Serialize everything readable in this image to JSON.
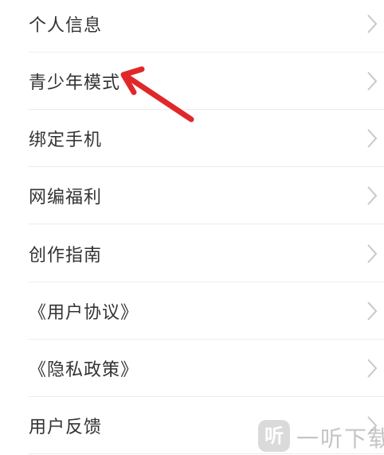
{
  "menu": {
    "items": [
      {
        "label": "个人信息"
      },
      {
        "label": "青少年模式"
      },
      {
        "label": "绑定手机"
      },
      {
        "label": "网编福利"
      },
      {
        "label": "创作指南"
      },
      {
        "label": "《用户协议》"
      },
      {
        "label": "《隐私政策》"
      },
      {
        "label": "用户反馈"
      }
    ],
    "chevron_icon": "chevron-right-icon",
    "chevron_color": "#c8c8c8",
    "text_color": "#333333"
  },
  "annotation": {
    "arrow_color": "#e0282a",
    "points_to": "青少年模式"
  },
  "watermark": {
    "logo_glyph": "听",
    "text": "一听下载"
  }
}
